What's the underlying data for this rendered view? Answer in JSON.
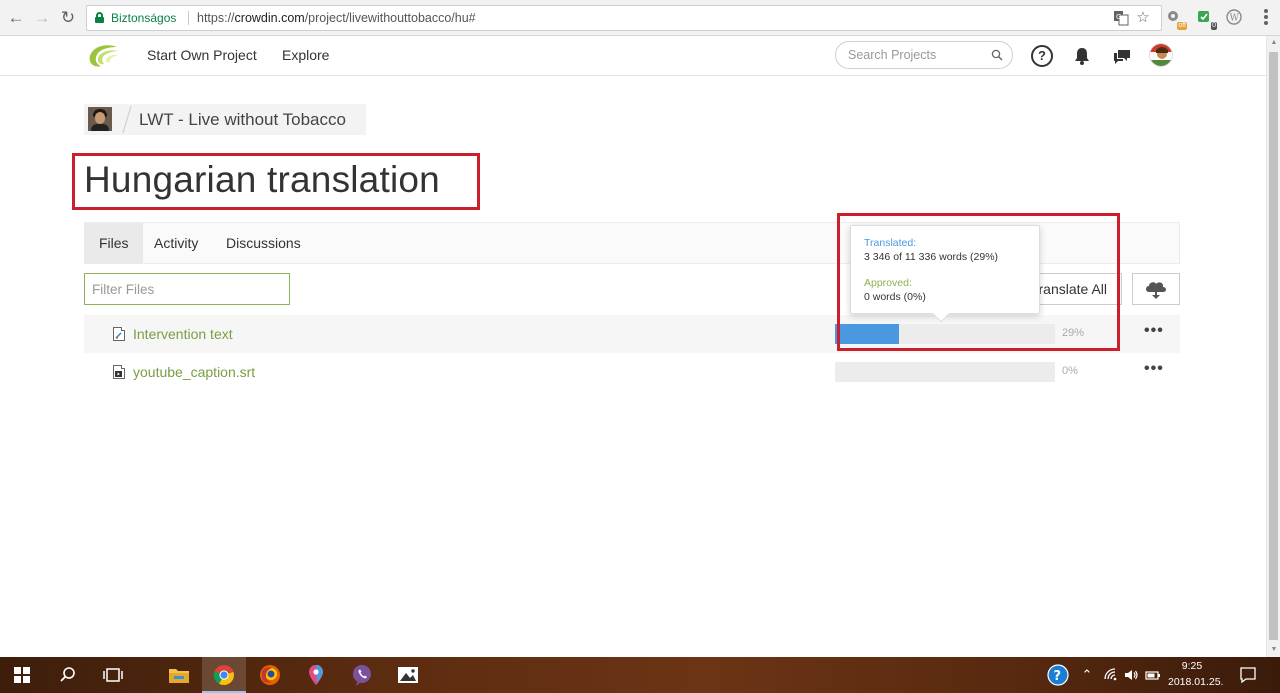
{
  "browser": {
    "secure_label": "Biztonságos",
    "url_protocol": "https://",
    "url_host": "crowdin.com",
    "url_path": "/project/livewithouttobacco/hu#",
    "ext_badges": {
      "off": "off",
      "count": "0"
    }
  },
  "header": {
    "nav": [
      {
        "label": "Start Own Project"
      },
      {
        "label": "Explore"
      }
    ],
    "search_placeholder": "Search Projects"
  },
  "breadcrumb": {
    "project_name": "LWT - Live without Tobacco"
  },
  "page": {
    "title": "Hungarian translation"
  },
  "tabs": [
    {
      "label": "Files",
      "active": true
    },
    {
      "label": "Activity",
      "active": false
    },
    {
      "label": "Discussions",
      "active": false
    }
  ],
  "toolbar": {
    "filter_placeholder": "Filter Files",
    "translate_all_label": "Translate All"
  },
  "files": [
    {
      "name": "Intervention text",
      "progress_percent": 29,
      "progress_label": "29%",
      "icon": "document-edit-icon"
    },
    {
      "name": "youtube_caption.srt",
      "progress_percent": 0,
      "progress_label": "0%",
      "icon": "video-file-icon"
    }
  ],
  "tooltip": {
    "translated_label": "Translated:",
    "translated_value": "3 346 of 11 336 words (29%)",
    "approved_label": "Approved:",
    "approved_value": "0 words (0%)"
  },
  "taskbar": {
    "time": "9:25",
    "date": "2018.01.25."
  },
  "colors": {
    "accent_green": "#7a9e44",
    "progress_blue": "#4a98e0",
    "highlight_red": "#cc1f2d",
    "translated_label": "#4a98e0",
    "approved_label": "#8bb24b"
  }
}
